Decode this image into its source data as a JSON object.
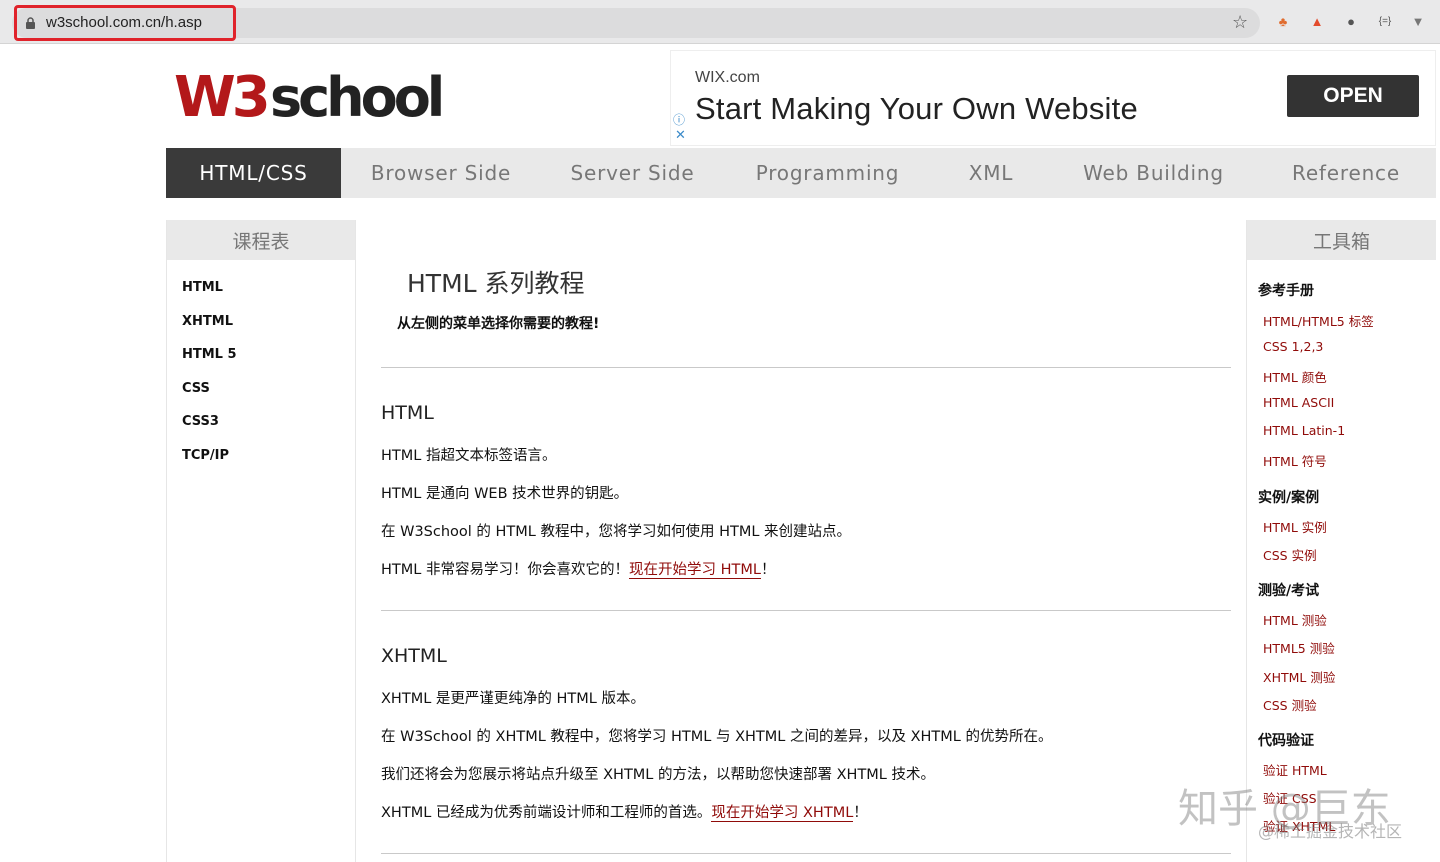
{
  "browser": {
    "url": "w3school.com.cn/h.asp",
    "star_icon": "bookmark-star-icon",
    "extensions": [
      "extension-icon-1",
      "extension-icon-2",
      "extension-icon-3",
      "extension-icon-4",
      "extension-icon-5"
    ]
  },
  "ad": {
    "domain": "WIX.com",
    "title": "Start Making Your Own Website",
    "open_label": "OPEN",
    "info_glyph": "ⓘ",
    "close_glyph": "✕"
  },
  "nav": {
    "items": [
      {
        "label": "HTML/CSS"
      },
      {
        "label": "Browser Side"
      },
      {
        "label": "Server Side"
      },
      {
        "label": "Programming"
      },
      {
        "label": "XML"
      },
      {
        "label": "Web Building"
      },
      {
        "label": "Reference"
      }
    ]
  },
  "left_sidebar": {
    "title": "课程表",
    "items": [
      "HTML",
      "XHTML",
      "HTML 5",
      "CSS",
      "CSS3",
      "TCP/IP"
    ]
  },
  "main": {
    "title": "HTML 系列教程",
    "intro": "从左侧的菜单选择你需要的教程!",
    "sections": [
      {
        "title": "HTML",
        "paras": [
          "HTML 指超文本标签语言。",
          "HTML 是通向 WEB 技术世界的钥匙。",
          "在 W3School 的 HTML 教程中，您将学习如何使用 HTML 来创建站点。",
          "HTML 非常容易学习！你会喜欢它的！"
        ],
        "link": "现在开始学习 HTML",
        "link_suffix": "！"
      },
      {
        "title": "XHTML",
        "paras": [
          "XHTML 是更严谨更纯净的 HTML 版本。",
          "在 W3School 的 XHTML 教程中，您将学习 HTML 与 XHTML 之间的差异，以及 XHTML 的优势所在。",
          "我们还将会为您展示将站点升级至 XHTML 的方法，以帮助您快速部署 XHTML 技术。",
          "XHTML 已经成为优秀前端设计师和工程师的首选。"
        ],
        "link": "现在开始学习 XHTML",
        "link_suffix": "！"
      }
    ]
  },
  "right_sidebar": {
    "title": "工具箱",
    "groups": [
      {
        "title": "参考手册",
        "links": [
          "HTML/HTML5 标签",
          "CSS 1,2,3",
          "HTML 颜色",
          "HTML ASCII",
          "HTML Latin-1",
          "HTML 符号"
        ]
      },
      {
        "title": "实例/案例",
        "links": [
          "HTML 实例",
          "CSS 实例"
        ]
      },
      {
        "title": "测验/考试",
        "links": [
          "HTML 测验",
          "HTML5 测验",
          "XHTML 测验",
          "CSS 测验"
        ]
      },
      {
        "title": "代码验证",
        "links": [
          "验证 HTML",
          "验证 CSS",
          "验证 XHTML"
        ]
      }
    ]
  },
  "watermark": {
    "line1": "知乎 @巨东",
    "line2": "@稀土掘金技术社区"
  },
  "logo": {
    "text": "W3school"
  },
  "colors": {
    "accent": "#900b09",
    "nav_active": "#3a3a3a",
    "highlight": "#e0232b"
  }
}
